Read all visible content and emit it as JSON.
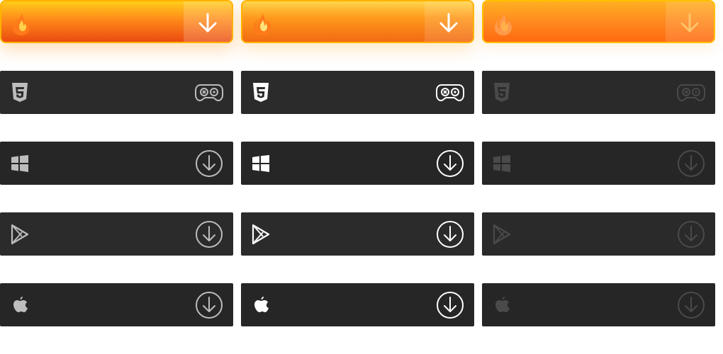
{
  "colors": {
    "fire_top": "#ffcc1a",
    "fire_mid": "#ff8a1a",
    "fire_bottom": "#ea4b10",
    "fire_border": "#ffb300",
    "dark_bg": "#2b2b2b",
    "dark_bg_alt": "#262626",
    "icon_normal": "#bdbdbd",
    "icon_hover": "#ffffff",
    "icon_disabled": "#4a4a4a"
  },
  "columns": [
    "normal",
    "hover",
    "disabled"
  ],
  "rows": [
    {
      "id": "fire",
      "left_icon": "fire-icon",
      "right_icon": "arrow-down-icon"
    },
    {
      "id": "html5",
      "left_icon": "html5-icon",
      "right_icon": "gamepad-icon"
    },
    {
      "id": "windows",
      "left_icon": "windows-icon",
      "right_icon": "download-circle-icon"
    },
    {
      "id": "google-play",
      "left_icon": "google-play-icon",
      "right_icon": "download-circle-icon"
    },
    {
      "id": "apple",
      "left_icon": "apple-icon",
      "right_icon": "download-circle-icon"
    }
  ]
}
